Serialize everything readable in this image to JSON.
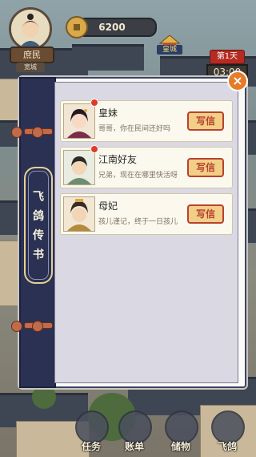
{
  "hud": {
    "player_rank": "庶民",
    "player_title": "宽城",
    "coins": "6200",
    "city_label": "皇城",
    "day_label": "第1天",
    "clock": "03:00"
  },
  "dialog": {
    "banner_title": "飞鸽传书",
    "close_icon": "×",
    "write_label": "写信",
    "letters": [
      {
        "name": "皇妹",
        "message": "哥哥，你在民间还好吗",
        "unread": true,
        "portrait": "princess-portrait"
      },
      {
        "name": "江南好友",
        "message": "兄弟，现在在哪里快活呀",
        "unread": true,
        "portrait": "friend-portrait"
      },
      {
        "name": "母妃",
        "message": "孩儿谨记，终于一日孩儿",
        "unread": false,
        "portrait": "mother-portrait"
      }
    ]
  },
  "bottom_nav": [
    {
      "label": "任务",
      "icon": "task-icon"
    },
    {
      "label": "账单",
      "icon": "ledger-icon"
    },
    {
      "label": "储物",
      "icon": "storage-icon"
    },
    {
      "label": "飞鸽",
      "icon": "pigeon-icon"
    }
  ],
  "colors": {
    "panel_blue": "#2a3153",
    "write_red": "#b8412f",
    "badge_red": "#e03a2a"
  }
}
